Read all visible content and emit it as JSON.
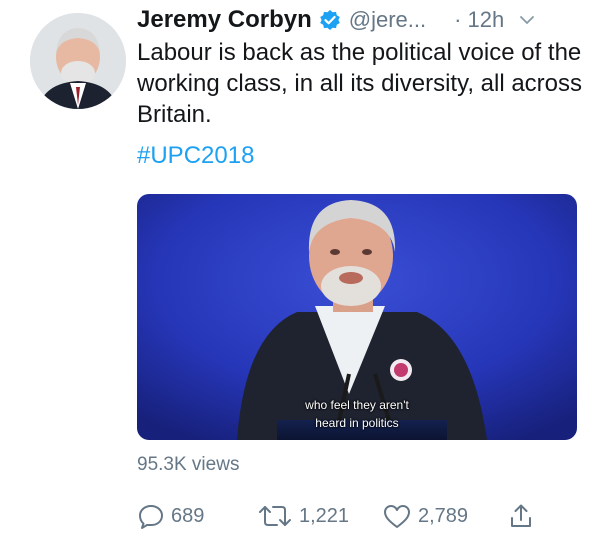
{
  "tweet": {
    "author_name": "Jeremy Corbyn",
    "handle": "@jere...",
    "time": "· 12h",
    "text": "Labour is back as the political voice of the working class, in all its diversity, all across Britain.",
    "hashtag": "#UPC2018",
    "media": {
      "subtitle_line1": "who feel they aren't",
      "subtitle_line2": "heard in politics"
    },
    "views": "95.3K views",
    "actions": {
      "reply_count": "689",
      "retweet_count": "1,221",
      "like_count": "2,789"
    }
  },
  "icons": {
    "verified": "verified-badge-icon",
    "caret": "chevron-down-icon",
    "reply": "reply-icon",
    "retweet": "retweet-icon",
    "like": "heart-icon",
    "share": "share-icon"
  },
  "colors": {
    "accent": "#1da1f2",
    "muted": "#657786",
    "text": "#14171a"
  }
}
